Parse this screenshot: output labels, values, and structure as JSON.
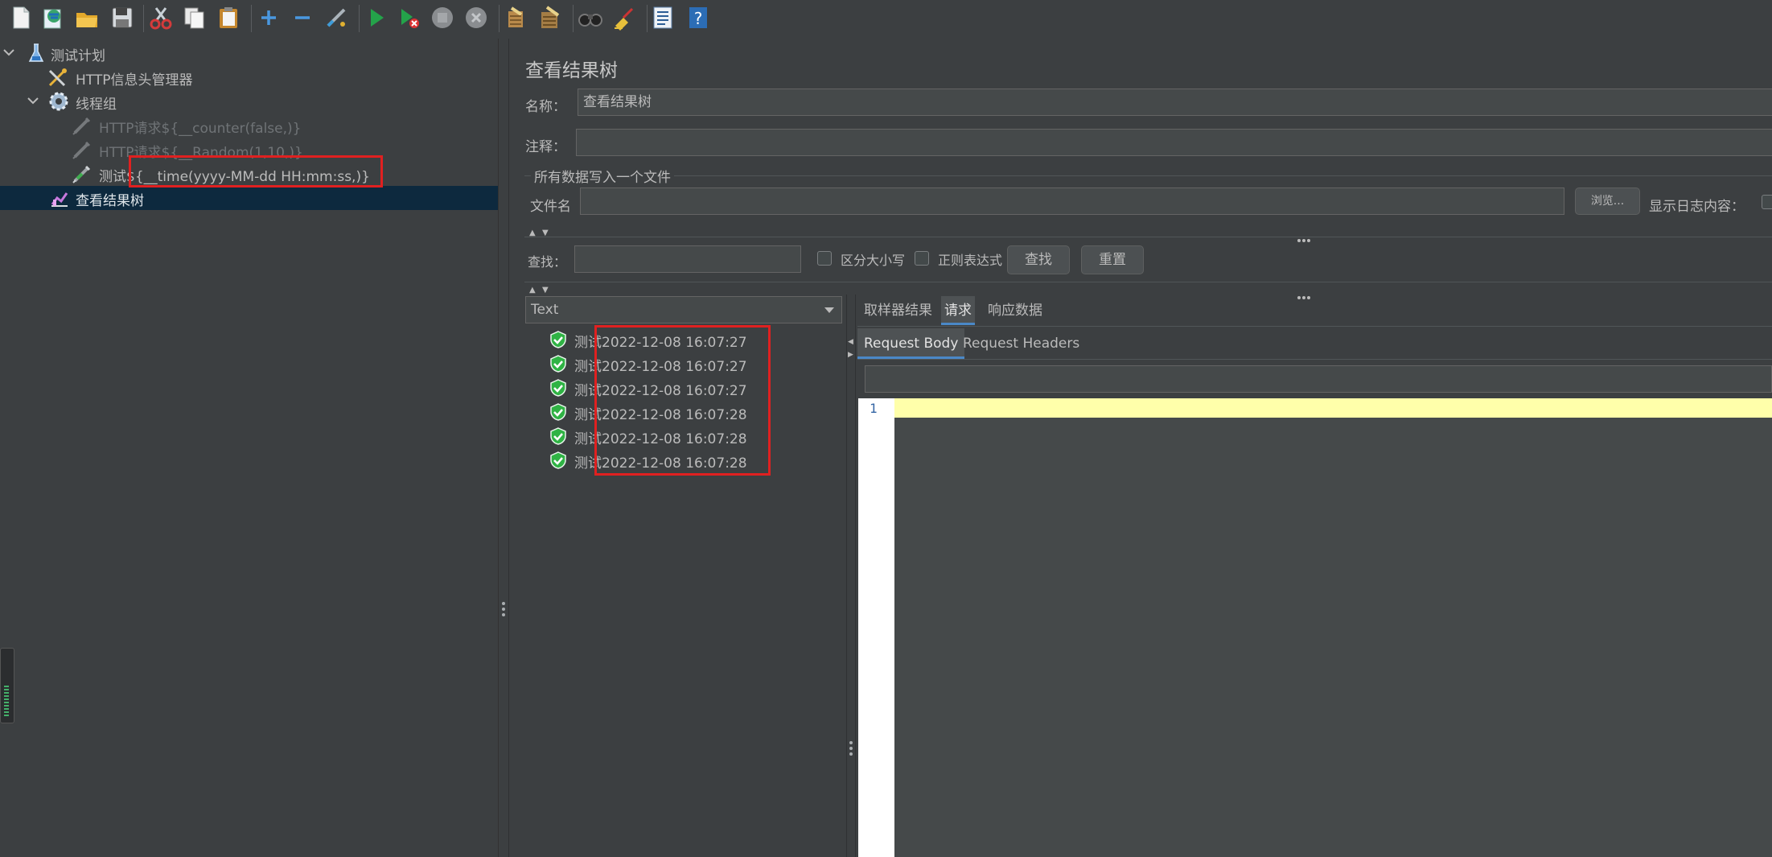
{
  "toolbar": {
    "buttons": [
      {
        "name": "new-icon"
      },
      {
        "name": "templates-icon"
      },
      {
        "name": "open-icon"
      },
      {
        "name": "save-icon"
      },
      {
        "name": "cut-icon"
      },
      {
        "name": "copy-icon"
      },
      {
        "name": "paste-icon"
      },
      {
        "name": "expand-icon"
      },
      {
        "name": "collapse-icon"
      },
      {
        "name": "toggle-icon"
      },
      {
        "name": "start-icon"
      },
      {
        "name": "start-no-pauses-icon"
      },
      {
        "name": "stop-icon"
      },
      {
        "name": "shutdown-icon"
      },
      {
        "name": "clear-icon"
      },
      {
        "name": "clear-all-icon"
      },
      {
        "name": "search-icon"
      },
      {
        "name": "reset-search-icon"
      },
      {
        "name": "function-helper-icon"
      },
      {
        "name": "help-icon"
      }
    ]
  },
  "tree": {
    "items": [
      {
        "label": "测试计划",
        "icon": "test-plan-icon",
        "expanded": true
      },
      {
        "label": "HTTP信息头管理器",
        "icon": "header-manager-icon"
      },
      {
        "label": "线程组",
        "icon": "thread-group-icon",
        "expanded": true
      },
      {
        "label": "HTTP请求${__counter(false,)}",
        "icon": "sampler-icon",
        "disabled": true
      },
      {
        "label": "HTTP请求${__Random(1,10,)}",
        "icon": "sampler-icon",
        "disabled": true
      },
      {
        "label": "测试${__time(yyyy-MM-dd HH:mm:ss,)}",
        "icon": "sampler-icon"
      },
      {
        "label": "查看结果树",
        "icon": "listener-icon",
        "selected": true
      }
    ]
  },
  "panel": {
    "title": "查看结果树",
    "name_label": "名称：",
    "name_value": "查看结果树",
    "comment_label": "注释：",
    "comment_value": "",
    "file_group_label": "所有数据写入一个文件",
    "filename_label": "文件名",
    "filename_value": "",
    "browse_button": "浏览...",
    "log_label": "显示日志内容：",
    "search_label": "查找：",
    "search_value": "",
    "case_sensitive_label": "区分大小写",
    "regex_label": "正则表达式",
    "find_button": "查找",
    "reset_button": "重置",
    "renderer_selected": "Text"
  },
  "results": [
    {
      "label": "测试2022-12-08 16:07:27",
      "status": "success"
    },
    {
      "label": "测试2022-12-08 16:07:27",
      "status": "success"
    },
    {
      "label": "测试2022-12-08 16:07:27",
      "status": "success"
    },
    {
      "label": "测试2022-12-08 16:07:28",
      "status": "success"
    },
    {
      "label": "测试2022-12-08 16:07:28",
      "status": "success"
    },
    {
      "label": "测试2022-12-08 16:07:28",
      "status": "success"
    }
  ],
  "detail": {
    "tabs": [
      "取样器结果",
      "请求",
      "响应数据"
    ],
    "active_tab": "请求",
    "subtabs": [
      "Request Body",
      "Request Headers"
    ],
    "active_subtab": "Request Body",
    "line_number": "1"
  },
  "colors": {
    "background": "#3c3f41",
    "selection": "#0d293e",
    "highlight_box": "#e02020",
    "current_line": "#ffffaa",
    "success": "#2fb344"
  }
}
